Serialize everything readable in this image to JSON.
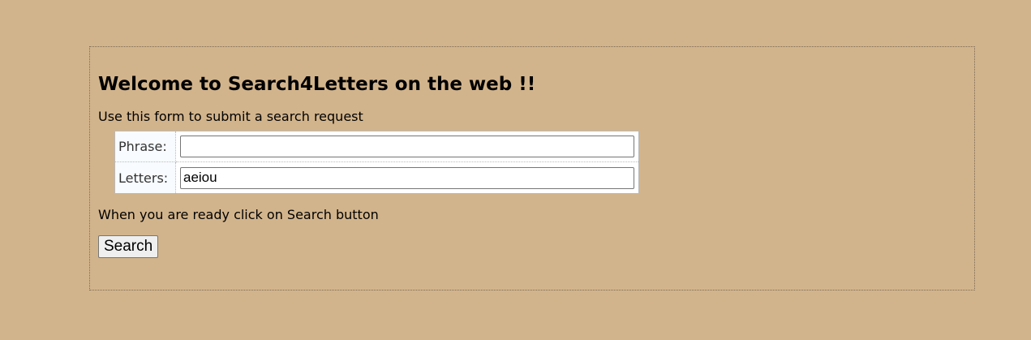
{
  "page": {
    "heading": "Welcome to Search4Letters on the web !!",
    "intro_text": "Use this form to submit a search request",
    "ready_text": "When you are ready click on Search button"
  },
  "form": {
    "phrase_label": "Phrase:",
    "phrase_value": "",
    "letters_label": "Letters:",
    "letters_value": "aeiou",
    "search_button_label": "Search"
  },
  "colors": {
    "page_background": "#d2b48c",
    "table_background": "#ffffff"
  }
}
